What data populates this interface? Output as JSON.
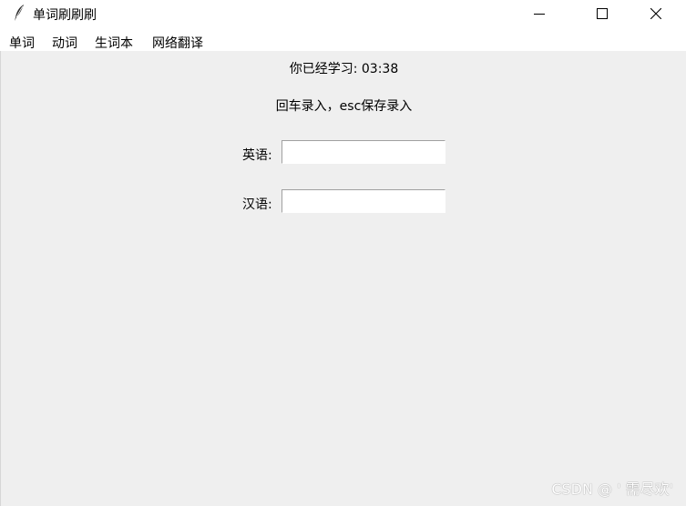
{
  "window": {
    "title": "单词刷刷刷",
    "icon": "feather-icon",
    "controls": [
      "minimize-icon",
      "maximize-icon",
      "close-icon"
    ]
  },
  "menu": {
    "items": [
      {
        "label": "单词"
      },
      {
        "label": "动词"
      },
      {
        "label": "生词本"
      },
      {
        "label": "网络翻译"
      }
    ]
  },
  "main": {
    "timer_text": "你已经学习: 03:38",
    "hint_text": "回车录入，esc保存录入",
    "english_label": "英语:",
    "english_value": "",
    "chinese_label": "汉语:",
    "chinese_value": ""
  },
  "watermark": "CSDN @ ' 需尽欢'",
  "colors": {
    "client_bg": "#efefef",
    "titlebar_bg": "#ffffff"
  }
}
